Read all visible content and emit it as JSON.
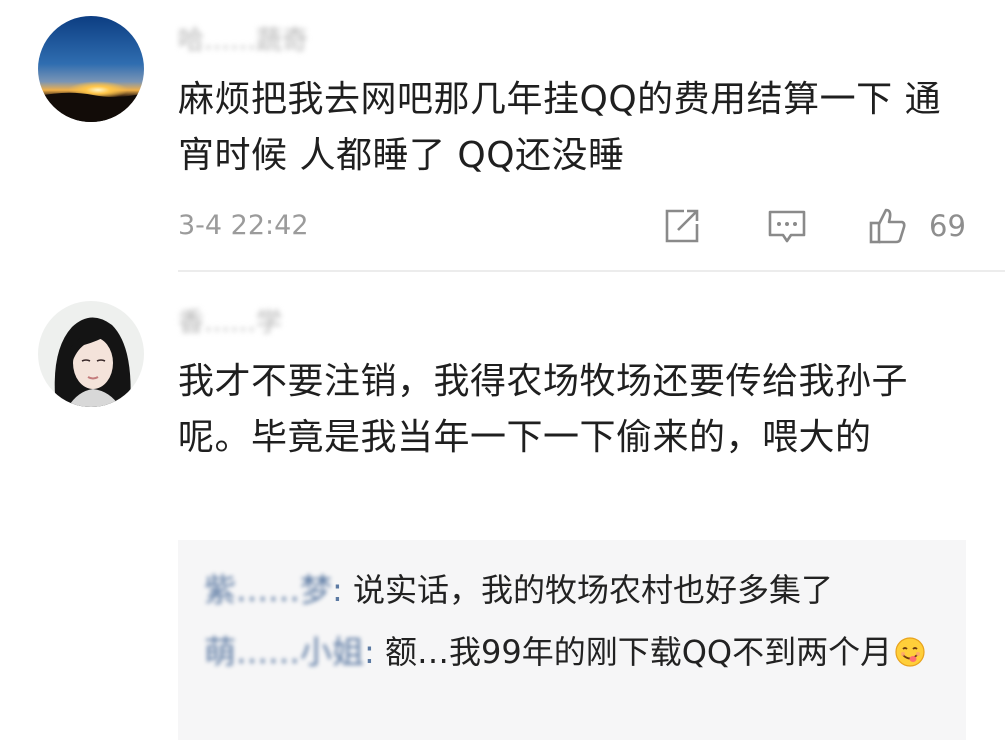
{
  "comments": [
    {
      "username": "哈……蔬奇",
      "body": "麻烦把我去网吧那几年挂QQ的费用结算一下 通宵时候 人都睡了 QQ还没睡",
      "timestamp": "3-4 22:42",
      "likes": "69",
      "icons": [
        "share-icon",
        "reply-icon",
        "like-icon"
      ]
    },
    {
      "username": "香……学",
      "body": "我才不要注销，我得农场牧场还要传给我孙子呢。毕竟是我当年一下一下偷来的，喂大的",
      "replies": [
        {
          "name": "紫……梦",
          "colon": ":",
          "text": " 说实话，我的牧场农村也好多集了"
        },
        {
          "name": "萌……小姐",
          "colon": ":",
          "text": " 额…我99年的刚下载QQ不到两个月",
          "emoji": "yum-face-emoji"
        }
      ]
    }
  ],
  "colors": {
    "username": "#b4b4b4",
    "body": "#1f1f1f",
    "meta": "#9b9b9b",
    "reply_name": "#5c7aa3",
    "reply_bg": "#f6f6f7"
  }
}
